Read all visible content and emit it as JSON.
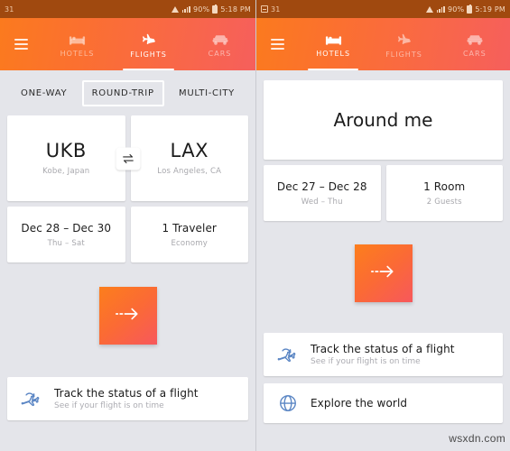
{
  "left_screen": {
    "statusbar": {
      "left_text": "31",
      "battery_percent": "90%",
      "time": "5:18 PM",
      "icons": [
        "wifi-icon",
        "signal-icon",
        "battery-icon"
      ]
    },
    "header": {
      "menu_icon": "hamburger-menu-icon",
      "tabs": [
        {
          "label": "HOTELS",
          "icon": "bed-icon",
          "active": false
        },
        {
          "label": "FLIGHTS",
          "icon": "plane-icon",
          "active": true
        },
        {
          "label": "CARS",
          "icon": "car-icon",
          "active": false
        }
      ]
    },
    "trip_types": [
      {
        "label": "ONE-WAY",
        "selected": false
      },
      {
        "label": "ROUND-TRIP",
        "selected": true
      },
      {
        "label": "MULTI-CITY",
        "selected": false
      }
    ],
    "origin": {
      "code": "UKB",
      "city": "Kobe, Japan"
    },
    "destination": {
      "code": "LAX",
      "city": "Los Angeles, CA"
    },
    "swap_icon": "swap-arrows-icon",
    "dates": {
      "value": "Dec 28 – Dec 30",
      "sub": "Thu – Sat"
    },
    "travelers": {
      "value": "1 Traveler",
      "sub": "Economy"
    },
    "search_button": {
      "icon": "dashed-arrow-right-icon"
    },
    "info_cards": [
      {
        "icon": "flight-status-icon",
        "title": "Track the status of a flight",
        "subtitle": "See if your flight is on time"
      }
    ]
  },
  "right_screen": {
    "statusbar": {
      "left_icon": "sd-card-icon",
      "left_text": "31",
      "battery_percent": "90%",
      "time": "5:19 PM",
      "icons": [
        "wifi-icon",
        "signal-icon",
        "battery-icon"
      ]
    },
    "header": {
      "menu_icon": "hamburger-menu-icon",
      "tabs": [
        {
          "label": "HOTELS",
          "icon": "bed-icon",
          "active": true
        },
        {
          "label": "FLIGHTS",
          "icon": "plane-icon",
          "active": false
        },
        {
          "label": "CARS",
          "icon": "car-icon",
          "active": false
        }
      ]
    },
    "location_card": {
      "label": "Around me"
    },
    "dates": {
      "value": "Dec 27 – Dec 28",
      "sub": "Wed – Thu"
    },
    "rooms": {
      "value": "1 Room",
      "sub": "2 Guests"
    },
    "search_button": {
      "icon": "dashed-arrow-right-icon"
    },
    "info_cards": [
      {
        "icon": "flight-status-icon",
        "title": "Track the status of a flight",
        "subtitle": "See if your flight is on time"
      },
      {
        "icon": "globe-icon",
        "title": "Explore the world",
        "subtitle": ""
      }
    ]
  },
  "watermark": "wsxdn.com",
  "colors": {
    "header_start": "#fb7a1e",
    "header_end": "#f65f5c",
    "statusbar": "#a0490f",
    "background": "#e4e5ea",
    "card": "#ffffff",
    "accent_icon": "#5b86c4"
  }
}
